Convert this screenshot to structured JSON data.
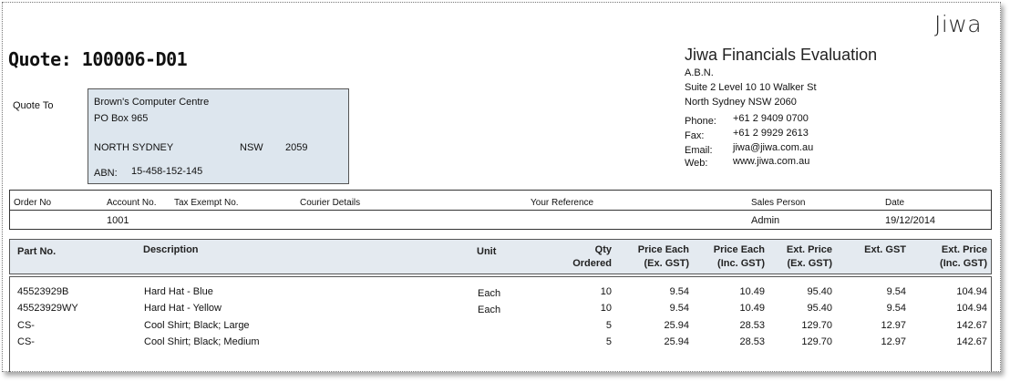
{
  "logo": "Jiwa",
  "quote": {
    "title": "Quote: 100006-D01"
  },
  "company": {
    "name": "Jiwa Financials Evaluation",
    "abn_label": "A.B.N.",
    "address_line1": "Suite 2 Level 10  10 Walker St",
    "address_line2": "North Sydney  NSW 2060",
    "phone_label": "Phone:",
    "phone": "+61 2 9409 0700",
    "fax_label": "Fax:",
    "fax": "+61 2 9929 2613",
    "email_label": "Email:",
    "email": "jiwa@jiwa.com.au",
    "web_label": "Web:",
    "web": "www.jiwa.com.au"
  },
  "quote_to": {
    "label": "Quote To",
    "name": "Brown's Computer Centre",
    "po_box": "PO Box 965",
    "city": "NORTH SYDNEY",
    "state": "NSW",
    "postcode": "2059",
    "abn_label": "ABN:",
    "abn": "15-458-152-145"
  },
  "order_info": {
    "headers": {
      "order_no": "Order No",
      "account_no": "Account No.",
      "tax_exempt_no": "Tax Exempt No.",
      "courier_details": "Courier Details",
      "your_reference": "Your Reference",
      "sales_person": "Sales Person",
      "date": "Date"
    },
    "values": {
      "order_no": "",
      "account_no": "1001",
      "tax_exempt_no": "",
      "courier_details": "",
      "your_reference": "",
      "sales_person": "Admin",
      "date": "19/12/2014"
    }
  },
  "lines": {
    "headers": {
      "part_no": "Part No.",
      "description": "Description",
      "unit": "Unit",
      "qty_1": "Qty",
      "qty_2": "Ordered",
      "price_ex_1": "Price Each",
      "price_ex_2": "(Ex. GST)",
      "price_inc_1": "Price Each",
      "price_inc_2": "(Inc. GST)",
      "ext_price_1": "Ext. Price",
      "ext_price_2": "(Ex. GST)",
      "ext_gst": "Ext. GST",
      "ext_inc_1": "Ext. Price",
      "ext_inc_2": "(Inc. GST)"
    },
    "rows": [
      {
        "part_no": "45523929B",
        "description": "Hard Hat - Blue",
        "unit": "Each",
        "qty": "10",
        "price_ex": "9.54",
        "price_inc": "10.49",
        "ext_price": "95.40",
        "ext_gst": "9.54",
        "ext_inc": "104.94"
      },
      {
        "part_no": "45523929WY",
        "description": "Hard Hat - Yellow",
        "unit": "Each",
        "qty": "10",
        "price_ex": "9.54",
        "price_inc": "10.49",
        "ext_price": "95.40",
        "ext_gst": "9.54",
        "ext_inc": "104.94"
      },
      {
        "part_no": "CS-",
        "description": "Cool Shirt; Black; Large",
        "unit": "",
        "qty": "5",
        "price_ex": "25.94",
        "price_inc": "28.53",
        "ext_price": "129.70",
        "ext_gst": "12.97",
        "ext_inc": "142.67"
      },
      {
        "part_no": "CS-",
        "description": "Cool Shirt; Black; Medium",
        "unit": "",
        "qty": "5",
        "price_ex": "25.94",
        "price_inc": "28.53",
        "ext_price": "129.70",
        "ext_gst": "12.97",
        "ext_inc": "142.67"
      }
    ]
  }
}
